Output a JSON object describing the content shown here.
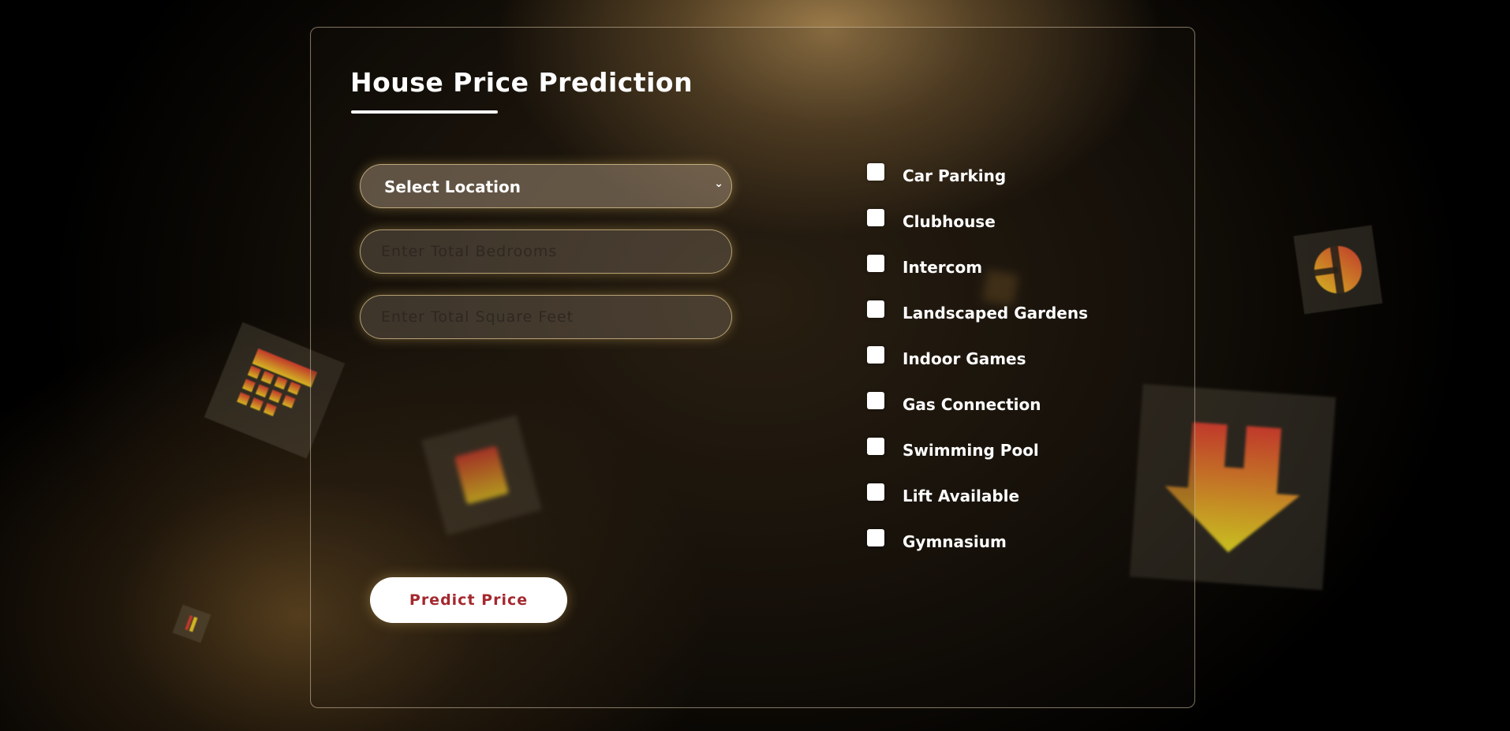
{
  "form": {
    "title": "House Price Prediction",
    "location_select": {
      "selected": "Select Location",
      "icon": "chevron-down-icon"
    },
    "bedrooms_input": {
      "value": "",
      "placeholder": "Enter Total Bedrooms"
    },
    "sqft_input": {
      "value": "",
      "placeholder": "Enter Total Square Feet"
    },
    "predict_button_label": "Predict Price",
    "amenities": [
      {
        "label": "Car Parking",
        "checked": false
      },
      {
        "label": "Clubhouse",
        "checked": false
      },
      {
        "label": "Intercom",
        "checked": false
      },
      {
        "label": "Landscaped Gardens",
        "checked": false
      },
      {
        "label": "Indoor Games",
        "checked": false
      },
      {
        "label": "Gas Connection",
        "checked": false
      },
      {
        "label": "Swimming Pool",
        "checked": false
      },
      {
        "label": "Lift Available",
        "checked": false
      },
      {
        "label": "Gymnasium",
        "checked": false
      }
    ]
  },
  "colors": {
    "button_text": "#a4282e",
    "title_text": "#ffffff",
    "field_glow": "#f0c86e"
  },
  "decorations": {
    "icons": [
      "building-grid-icon",
      "building-icon",
      "door-icon",
      "download-arrow-icon",
      "small-building-icon",
      "blurred-tile-icon"
    ]
  }
}
